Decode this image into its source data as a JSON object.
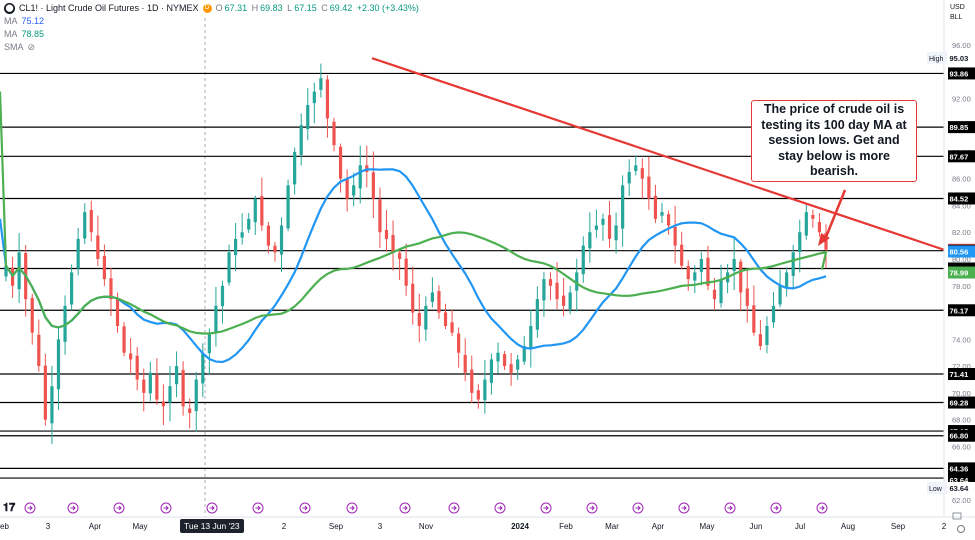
{
  "header": {
    "symbol": "CL1! · Light Crude Oil Futures · 1D · NYMEX",
    "open_label": "O",
    "open": "67.31",
    "high_label": "H",
    "high": "69.83",
    "low_label": "L",
    "low": "67.15",
    "close_label": "C",
    "close": "69.42",
    "change": "+2.30 (+3.43%)",
    "ma1_label": "MA",
    "ma1_value": "75.12",
    "ma2_label": "MA",
    "ma2_value": "78.85",
    "sma_label": "SMA"
  },
  "top_right": {
    "currency": "USD",
    "unit": "BLL"
  },
  "annotation": "The price of crude oil is testing its 100 day MA at session lows.  Get and stay below is more bearish.",
  "chart_data": {
    "type": "candlestick",
    "title": "CL1! · Light Crude Oil Futures · 1D · NYMEX",
    "ylim": [
      62,
      98
    ],
    "y_ticks": [
      62,
      64,
      66,
      68,
      70,
      72,
      74,
      76,
      78,
      80,
      82,
      84,
      86,
      88,
      90,
      92,
      94,
      96
    ],
    "x_tick_labels": [
      "Feb",
      "3",
      "Apr",
      "May",
      "Jun",
      "Jul",
      "2",
      "Sep",
      "3",
      "Nov",
      "2024",
      "Feb",
      "Mar",
      "Apr",
      "May",
      "Jun",
      "Jul",
      "Aug",
      "Sep",
      "2"
    ],
    "date_cursor": "Tue 13 Jun '23",
    "price_tags": [
      {
        "label": "High",
        "value": "95.03"
      },
      {
        "label": "",
        "value": "93.86"
      },
      {
        "label": "",
        "value": "89.85"
      },
      {
        "label": "",
        "value": "87.67"
      },
      {
        "label": "",
        "value": "84.52"
      },
      {
        "label": "",
        "value": "80.69"
      },
      {
        "label": "",
        "value": "80.62"
      },
      {
        "label": "",
        "value": "80.56"
      },
      {
        "label": "",
        "value": "79.29"
      },
      {
        "label": "",
        "value": "78.99"
      },
      {
        "label": "",
        "value": "76.17"
      },
      {
        "label": "",
        "value": "71.41"
      },
      {
        "label": "",
        "value": "69.28"
      },
      {
        "label": "",
        "value": "67.15"
      },
      {
        "label": "",
        "value": "66.80"
      },
      {
        "label": "",
        "value": "64.36"
      },
      {
        "label": "",
        "value": "63.64"
      },
      {
        "label": "Low",
        "value": "63.64"
      }
    ],
    "horizontal_levels": [
      93.86,
      89.85,
      87.67,
      84.52,
      80.62,
      79.29,
      76.17,
      71.41,
      69.28,
      67.15,
      66.8,
      64.36,
      63.64
    ],
    "trendline": {
      "start": 95.0,
      "end": 80.69
    },
    "close_series": [
      79.5,
      78.0,
      80.5,
      77.0,
      74.5,
      72.0,
      68.0,
      70.5,
      74.0,
      76.5,
      79.0,
      81.5,
      83.5,
      82.0,
      80.0,
      78.5,
      77.0,
      75.0,
      73.0,
      72.5,
      71.0,
      70.0,
      71.5,
      69.5,
      69.0,
      70.5,
      72.0,
      69.0,
      68.5,
      71.0,
      73.0,
      74.5,
      76.5,
      78.0,
      80.5,
      81.5,
      82.0,
      83.0,
      84.5,
      82.5,
      81.0,
      80.5,
      82.5,
      85.5,
      88.0,
      90.0,
      91.5,
      92.5,
      93.5,
      90.5,
      88.5,
      86.0,
      84.5,
      85.5,
      87.0,
      86.5,
      84.5,
      82.0,
      81.5,
      80.5,
      80.0,
      78.0,
      76.0,
      75.0,
      76.5,
      77.5,
      76.0,
      75.0,
      74.5,
      73.0,
      71.5,
      70.0,
      69.5,
      71.0,
      72.5,
      73.0,
      72.0,
      71.5,
      72.5,
      73.5,
      75.0,
      77.0,
      78.5,
      78.0,
      77.0,
      76.5,
      77.5,
      79.0,
      81.0,
      82.0,
      82.5,
      83.0,
      81.5,
      82.5,
      85.5,
      86.5,
      87.0,
      86.0,
      84.5,
      83.0,
      83.5,
      82.5,
      81.0,
      79.5,
      78.5,
      79.0,
      80.0,
      78.0,
      77.0,
      78.5,
      79.0,
      80.0,
      77.5,
      76.5,
      74.5,
      73.5,
      75.0,
      76.5,
      78.0,
      79.0,
      80.5,
      82.0,
      83.5,
      83.0,
      82.0,
      80.69
    ],
    "series": [
      {
        "name": "MA",
        "value": "75.12",
        "color": "#2196f3"
      },
      {
        "name": "MA",
        "value": "78.85",
        "color": "#43a047"
      }
    ]
  },
  "colors": {
    "up": "#26a69a",
    "down": "#ef5350",
    "ma_blue": "#2196f3",
    "ma_green": "#4caf50",
    "trend": "#e53935",
    "last_price": "#ef5350"
  }
}
